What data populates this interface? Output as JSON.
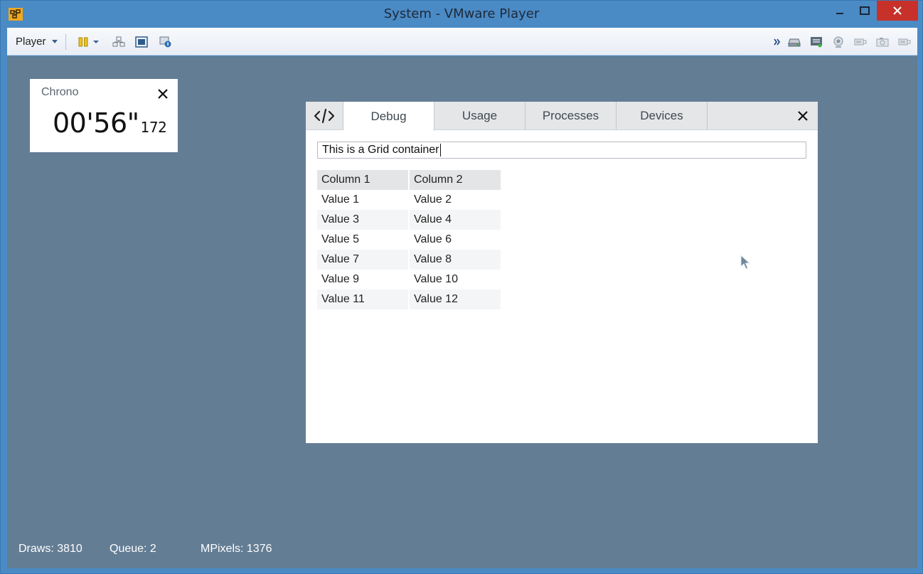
{
  "window": {
    "title": "System - VMware Player",
    "close_bg": "#c7312a"
  },
  "toolbar": {
    "player_menu": "Player",
    "left_icons": [
      "pause-icon",
      "dropdown-caret-icon",
      "send-ctrl-alt-del-icon",
      "fullscreen-icon",
      "unity-icon"
    ],
    "right_icons": [
      "overflow-chevron-icon",
      "hard-disk-icon",
      "network-adapter-icon",
      "webcam-icon",
      "usb-device-icon",
      "camera-icon",
      "usb-device-icon"
    ]
  },
  "chrono": {
    "title": "Chrono",
    "time": "00'56\"",
    "ms": "172"
  },
  "panel": {
    "tabs": [
      {
        "label": "Debug",
        "active": true
      },
      {
        "label": "Usage",
        "active": false
      },
      {
        "label": "Processes",
        "active": false
      },
      {
        "label": "Devices",
        "active": false
      }
    ],
    "text_field_value": "This is a Grid container",
    "grid": {
      "headers": [
        "Column 1",
        "Column 2"
      ],
      "rows": [
        [
          "Value 1",
          "Value 2"
        ],
        [
          "Value 3",
          "Value 4"
        ],
        [
          "Value 5",
          "Value 6"
        ],
        [
          "Value 7",
          "Value 8"
        ],
        [
          "Value 9",
          "Value 10"
        ],
        [
          "Value 11",
          "Value 12"
        ]
      ]
    }
  },
  "stats": {
    "draws": "Draws: 3810",
    "queue": "Queue: 2",
    "mpixels": "MPixels: 1376"
  },
  "colors": {
    "desktop": "#637d94",
    "accent": "#4a8ac5"
  }
}
